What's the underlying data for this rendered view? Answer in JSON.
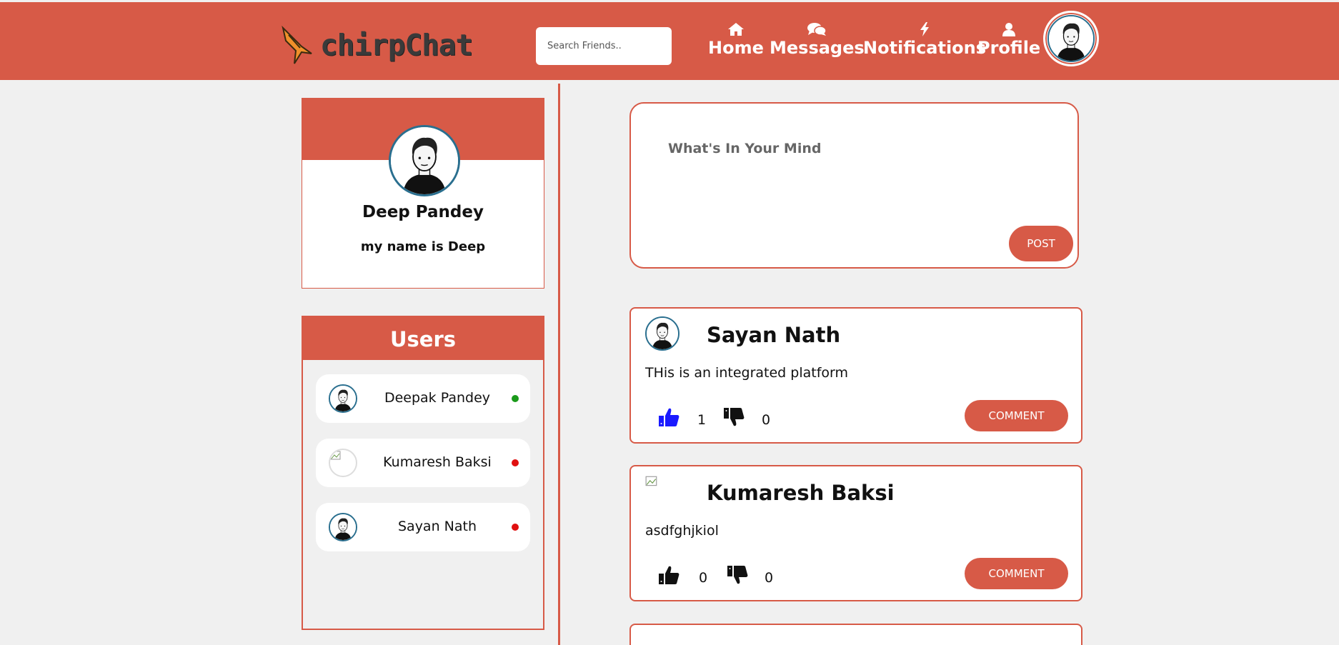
{
  "header": {
    "logo_text": "chirpChat",
    "search_placeholder": "Search Friends..",
    "nav": [
      {
        "label": "Home",
        "icon": "home-icon"
      },
      {
        "label": "Messages",
        "icon": "messages-icon"
      },
      {
        "label": "Notifications",
        "icon": "bolt-icon"
      },
      {
        "label": "Profile",
        "icon": "user-icon"
      }
    ]
  },
  "profile": {
    "name": "Deep Pandey",
    "bio": "my name is Deep"
  },
  "users": {
    "title": "Users",
    "items": [
      {
        "name": "Deepak Pandey",
        "status": "online",
        "status_color": "#1a9a1a"
      },
      {
        "name": "Kumaresh Baksi",
        "status": "offline",
        "status_color": "#e01010"
      },
      {
        "name": "Sayan Nath",
        "status": "offline",
        "status_color": "#e01010"
      }
    ]
  },
  "composer": {
    "placeholder": "What's In Your Mind",
    "post_label": "POST"
  },
  "posts": [
    {
      "author": "Sayan Nath",
      "text": "THis is an integrated platform",
      "likes": "1",
      "dislikes": "0",
      "liked": true,
      "comment_label": "COMMENT"
    },
    {
      "author": "Kumaresh Baksi",
      "text": "asdfghjkiol",
      "likes": "0",
      "dislikes": "0",
      "liked": false,
      "comment_label": "COMMENT"
    }
  ],
  "colors": {
    "accent": "#d75a47",
    "liked": "#1a1aff",
    "avatar_border": "#2a6f8f"
  }
}
